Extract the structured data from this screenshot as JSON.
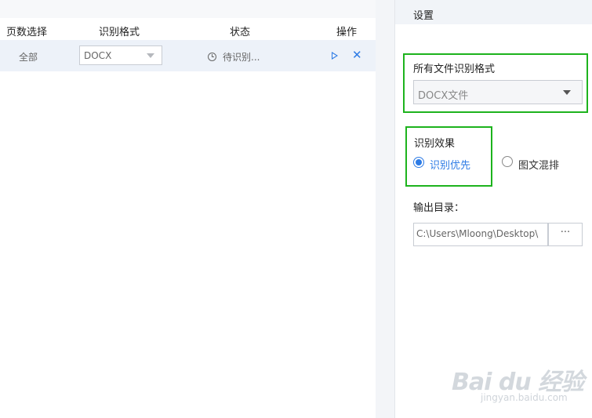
{
  "table": {
    "headers": {
      "pages": "页数选择",
      "format": "识别格式",
      "status": "状态",
      "actions": "操作"
    },
    "rows": [
      {
        "pages": "全部",
        "format": "DOCX",
        "status": "待识别..."
      }
    ]
  },
  "settings": {
    "title": "设置",
    "all_format_label": "所有文件识别格式",
    "all_format_value": "DOCX文件",
    "effect_label": "识别效果",
    "effect_options": [
      "识别优先",
      "图文混排"
    ],
    "effect_selected": "识别优先",
    "output_label": "输出目录：",
    "output_path": "C:\\Users\\Mloong\\Desktop\\",
    "browse_label": "···"
  },
  "watermark": {
    "main": "Bai du 经验",
    "sub": "jingyan.baidu.com"
  },
  "colors": {
    "accent": "#2d7be5",
    "highlight_box": "#1db31d"
  },
  "icons": {
    "status": "clock-icon",
    "start": "play-icon",
    "remove": "close-icon",
    "dropdown": "caret-down-icon"
  }
}
